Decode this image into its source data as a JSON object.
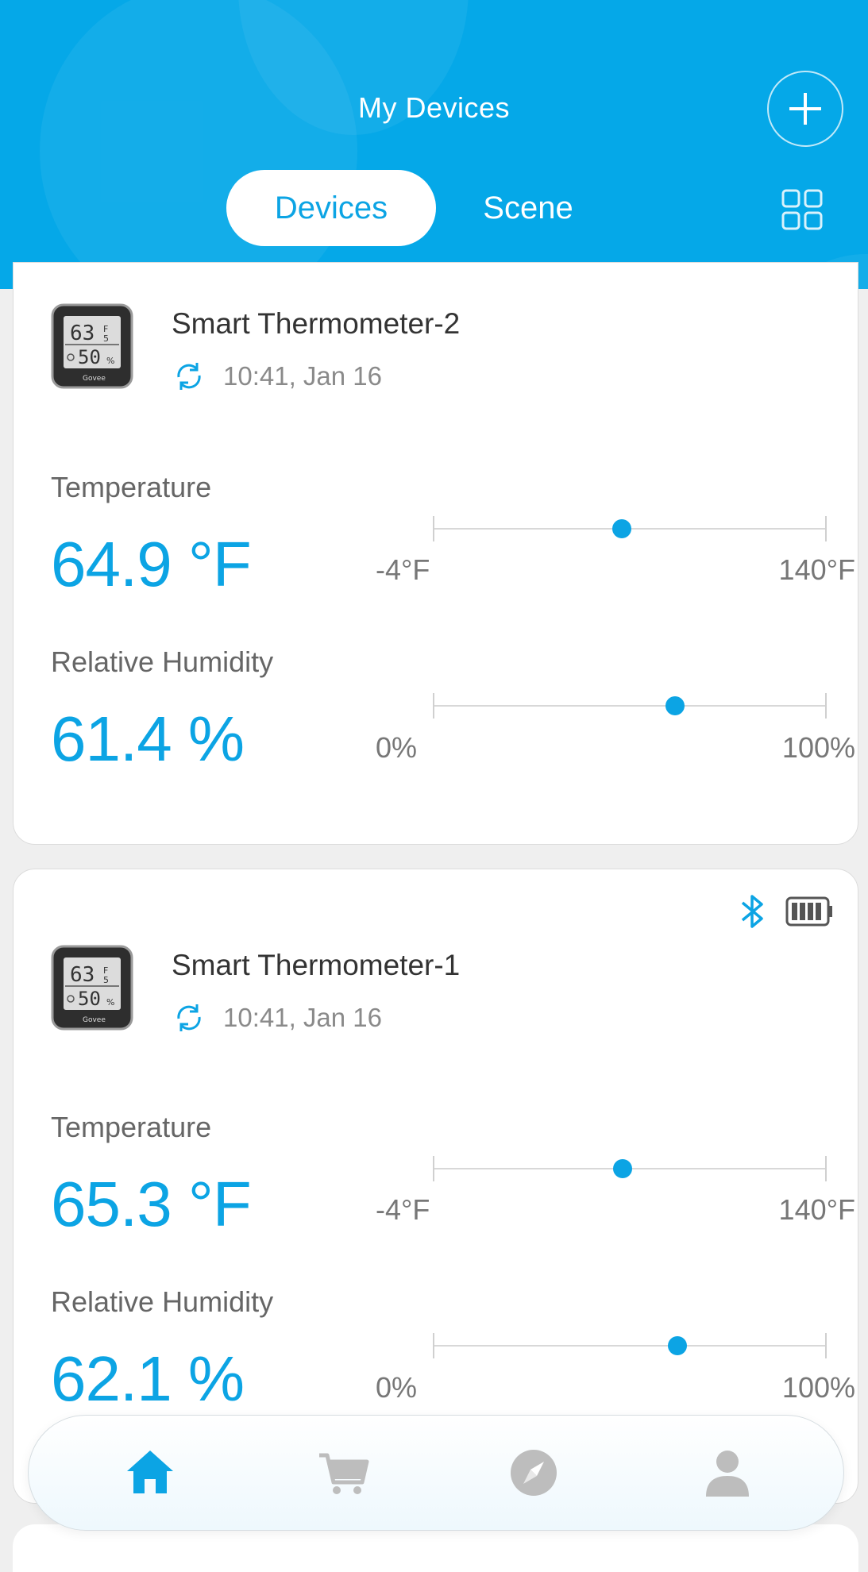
{
  "header": {
    "title": "My Devices",
    "tabs": [
      {
        "label": "Devices",
        "active": true
      },
      {
        "label": "Scene",
        "active": false
      }
    ],
    "accent_color": "#05a8e8"
  },
  "devices": [
    {
      "name": "Smart Thermometer-2",
      "sync_time": "10:41,  Jan 16",
      "temperature": {
        "label": "Temperature",
        "value": "64.9 °F",
        "min_label": "-4°F",
        "max_label": "140°F",
        "level": 0.48
      },
      "humidity": {
        "label": "Relative Humidity",
        "value": "61.4 %",
        "min_label": "0%",
        "max_label": "100%",
        "level": 0.614
      }
    },
    {
      "name": "Smart Thermometer-1",
      "sync_time": "10:41,  Jan 16",
      "status_icons": [
        "bluetooth-icon",
        "battery-full-icon"
      ],
      "temperature": {
        "label": "Temperature",
        "value": "65.3 °F",
        "min_label": "-4°F",
        "max_label": "140°F",
        "level": 0.481
      },
      "humidity": {
        "label": "Relative Humidity",
        "value": "62.1 %",
        "min_label": "0%",
        "max_label": "100%",
        "level": 0.621
      }
    }
  ],
  "bottom_nav": [
    {
      "icon": "home-icon",
      "active": true
    },
    {
      "icon": "cart-icon",
      "active": false
    },
    {
      "icon": "compass-icon",
      "active": false
    },
    {
      "icon": "profile-icon",
      "active": false
    }
  ]
}
